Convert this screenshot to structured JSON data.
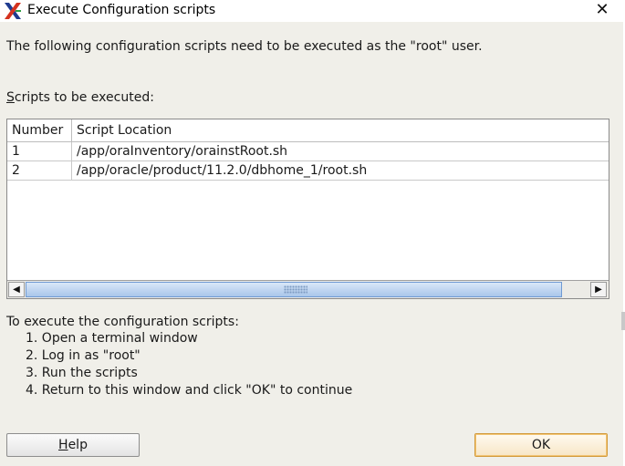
{
  "window": {
    "title": "Execute Configuration scripts",
    "close_glyph": "✕",
    "app_icon": "oracle-x-icon"
  },
  "intro_text": "The following configuration scripts need to be executed as the \"root\" user.",
  "scripts_label": {
    "mnemonic": "S",
    "rest": "cripts to be executed:"
  },
  "table": {
    "columns": [
      "Number",
      "Script Location"
    ],
    "rows": [
      {
        "number": "1",
        "location": "/app/oraInventory/orainstRoot.sh"
      },
      {
        "number": "2",
        "location": "/app/oracle/product/11.2.0/dbhome_1/root.sh"
      }
    ]
  },
  "scrollbar": {
    "left_arrow": "◀",
    "right_arrow": "▶"
  },
  "instructions": {
    "heading": "To execute the configuration scripts:",
    "steps": [
      "1. Open a terminal window",
      "2. Log in as \"root\"",
      "3. Run the scripts",
      "4. Return to this window and click \"OK\" to continue"
    ]
  },
  "buttons": {
    "help": {
      "mnemonic": "H",
      "rest": "elp"
    },
    "ok": "OK"
  },
  "colors": {
    "dialog_bg": "#f0efe9",
    "ok_border": "#d29a3c",
    "scroll_thumb": "#a9c6ea"
  }
}
